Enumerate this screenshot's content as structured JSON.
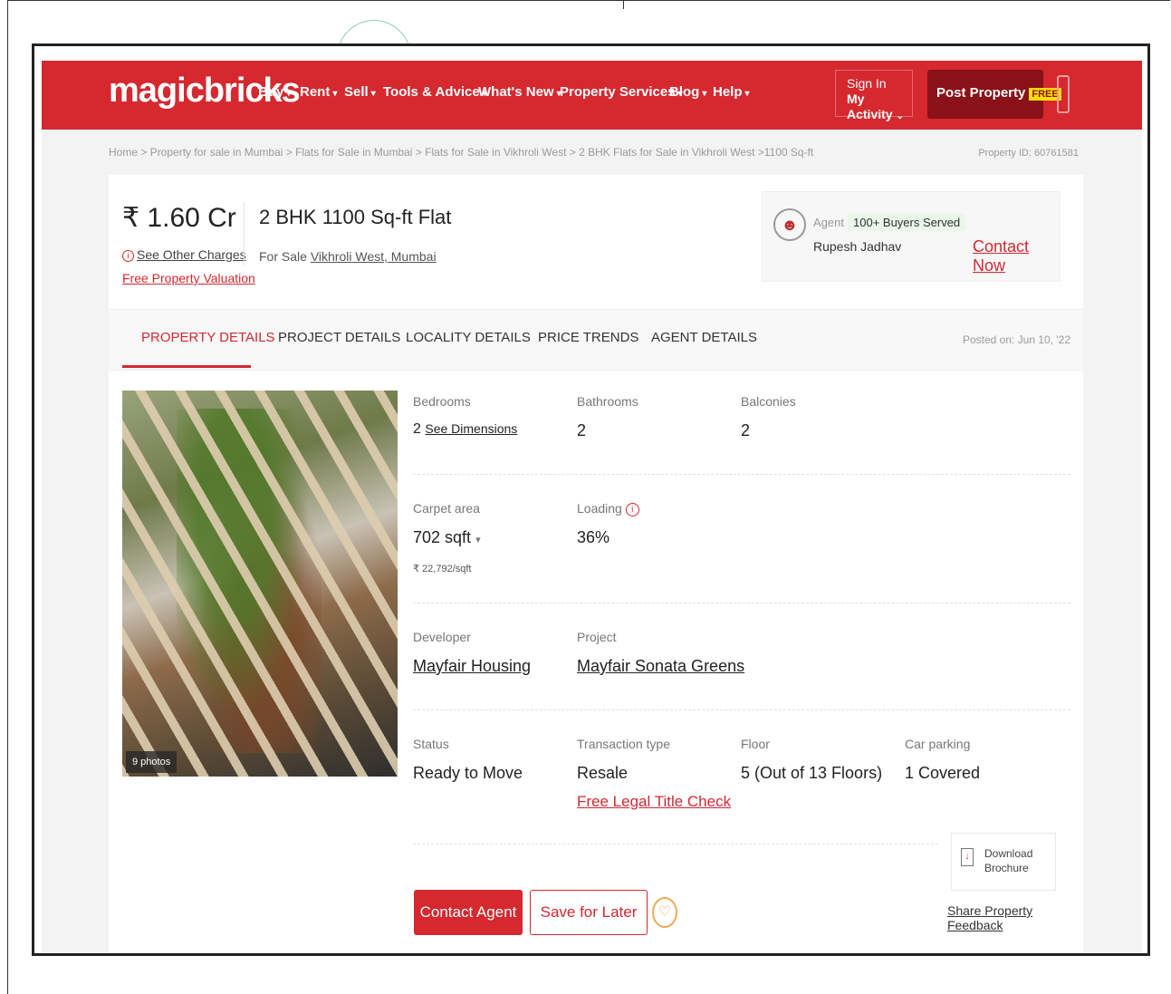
{
  "header": {
    "logo": "magicbricks",
    "nav": [
      {
        "label": "Buy"
      },
      {
        "label": "Rent"
      },
      {
        "label": "Sell"
      },
      {
        "label": "Tools & Advice"
      },
      {
        "label": "What's New"
      },
      {
        "label": "Property Services"
      },
      {
        "label": "Blog"
      },
      {
        "label": "Help"
      }
    ],
    "signin_line1": "Sign In",
    "signin_line2": "My Activity",
    "post_property": "Post Property",
    "free_tag": "FREE"
  },
  "breadcrumb": "Home > Property for sale in Mumbai > Flats for Sale in Mumbai > Flats for Sale in Vikhroli West > 2 BHK Flats for Sale in Vikhroli West >1100 Sq-ft",
  "property_id": "Property ID: 60761581",
  "summary": {
    "price": "₹ 1.60 Cr",
    "other_charges": "See Other Charges",
    "valuation": "Free Property Valuation",
    "title": "2 BHK 1100 Sq-ft Flat",
    "for_sale_prefix": "For Sale",
    "location": "Vikhroli West, Mumbai"
  },
  "agent": {
    "label": "Agent",
    "badge": "100+ Buyers Served",
    "name": "Rupesh Jadhav",
    "contact": "Contact Now"
  },
  "tabs": [
    {
      "label": "PROPERTY DETAILS"
    },
    {
      "label": "PROJECT DETAILS"
    },
    {
      "label": "LOCALITY DETAILS"
    },
    {
      "label": "PRICE TRENDS"
    },
    {
      "label": "AGENT DETAILS"
    }
  ],
  "posted_on": "Posted on: Jun 10, '22",
  "photos_count": "9 photos",
  "details": {
    "bedrooms_label": "Bedrooms",
    "bedrooms_value": "2",
    "see_dimensions": "See Dimensions",
    "bathrooms_label": "Bathrooms",
    "bathrooms_value": "2",
    "balconies_label": "Balconies",
    "balconies_value": "2",
    "carpet_label": "Carpet area",
    "carpet_value": "702 sqft",
    "carpet_rate": "₹ 22,792/sqft",
    "loading_label": "Loading",
    "loading_value": "36%",
    "developer_label": "Developer",
    "developer_value": "Mayfair Housing",
    "project_label": "Project",
    "project_value": "Mayfair Sonata Greens",
    "status_label": "Status",
    "status_value": "Ready to Move",
    "transaction_label": "Transaction type",
    "transaction_value": "Resale",
    "legal_check": "Free Legal Title Check",
    "floor_label": "Floor",
    "floor_value": "5 (Out of 13 Floors)",
    "parking_label": "Car parking",
    "parking_value": "1 Covered"
  },
  "actions": {
    "download_line1": "Download",
    "download_line2": "Brochure",
    "share_feedback": "Share Property Feedback",
    "contact_agent": "Contact Agent",
    "save_later": "Save for Later"
  }
}
